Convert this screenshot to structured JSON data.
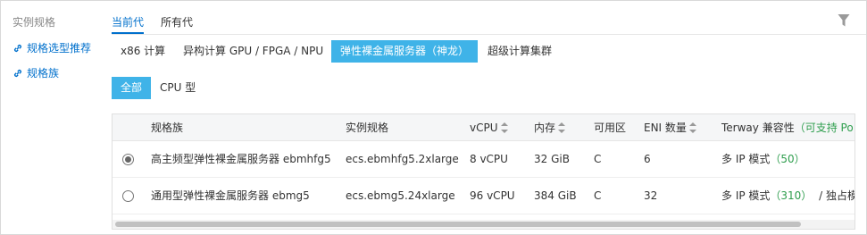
{
  "sidebar": {
    "title": "实例规格",
    "links": [
      {
        "label": "规格选型推荐",
        "icon": "link-icon"
      },
      {
        "label": "规格族",
        "icon": "link-icon"
      }
    ]
  },
  "generation_tabs": [
    {
      "label": "当前代",
      "active": true
    },
    {
      "label": "所有代",
      "active": false
    }
  ],
  "arch_tabs": [
    {
      "label": "x86 计算",
      "active": false
    },
    {
      "label": "异构计算 GPU / FPGA / NPU",
      "active": false
    },
    {
      "label": "弹性裸金属服务器（神龙）",
      "active": true
    },
    {
      "label": "超级计算集群",
      "active": false
    }
  ],
  "category_tabs": [
    {
      "label": "全部",
      "active": true
    },
    {
      "label": "CPU 型",
      "active": false
    }
  ],
  "table": {
    "headers": {
      "family": "规格族",
      "spec": "实例规格",
      "vcpu": "vCPU",
      "memory": "内存",
      "zone": "可用区",
      "eni": "ENI 数量",
      "terway": "Terway 兼容性",
      "terway_extra": "（可支持 Po"
    },
    "rows": [
      {
        "selected": true,
        "family": "高主频型弹性裸金属服务器 ebmhfg5",
        "spec": "ecs.ebmhfg5.2xlarge",
        "vcpu": "8 vCPU",
        "memory": "32 GiB",
        "zone": "C",
        "eni": "6",
        "terway_mode": "多 IP 模式",
        "terway_count": "（50）",
        "terway_extra": ""
      },
      {
        "selected": false,
        "family": "通用型弹性裸金属服务器 ebmg5",
        "spec": "ecs.ebmg5.24xlarge",
        "vcpu": "96 vCPU",
        "memory": "384 GiB",
        "zone": "C",
        "eni": "32",
        "terway_mode": "多 IP 模式",
        "terway_count": "（310）",
        "terway_extra": "/ 独占模"
      }
    ]
  },
  "colors": {
    "accent": "#0070cc",
    "active_tab_bg": "#3fb3e8",
    "green": "#2f9e4e"
  }
}
